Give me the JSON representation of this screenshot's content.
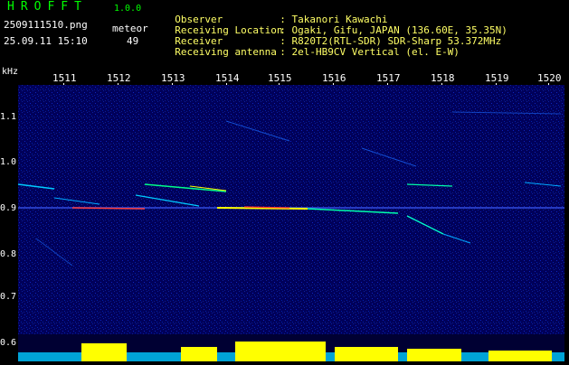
{
  "header": {
    "logo": "HROFFT",
    "version": "1.0.0",
    "filename": "2509111510.png",
    "datetime": "25.09.11 15:10",
    "meteor_label": "meteor",
    "meteor_count": "49"
  },
  "info": [
    {
      "key": "Observer",
      "value": "Takanori Kawachi"
    },
    {
      "key": "Receiving Location",
      "value": "Ogaki, Gifu, JAPAN (136.60E, 35.35N)"
    },
    {
      "key": "Receiver",
      "value": "R820T2(RTL-SDR) SDR-Sharp 53.372MHz"
    },
    {
      "key": "Receiving antenna",
      "value": "2el-HB9CV Vertical (el. E-W)"
    }
  ],
  "axis": {
    "y_unit": "kHz",
    "y_ticks": [
      "1.1",
      "1.0",
      "0.9",
      "0.8",
      "0.7",
      "0.6"
    ],
    "x_ticks": [
      "1511",
      "1512",
      "1513",
      "1514",
      "1515",
      "1516",
      "1517",
      "1518",
      "1519",
      "1520"
    ]
  },
  "colors": {
    "background": "#000000",
    "spectrogram": "#00005a",
    "trace_bright": "#ffff00",
    "trace_green": "#00ff88",
    "trace_cyan": "#00ccff",
    "level_bars": "#ffff00"
  }
}
